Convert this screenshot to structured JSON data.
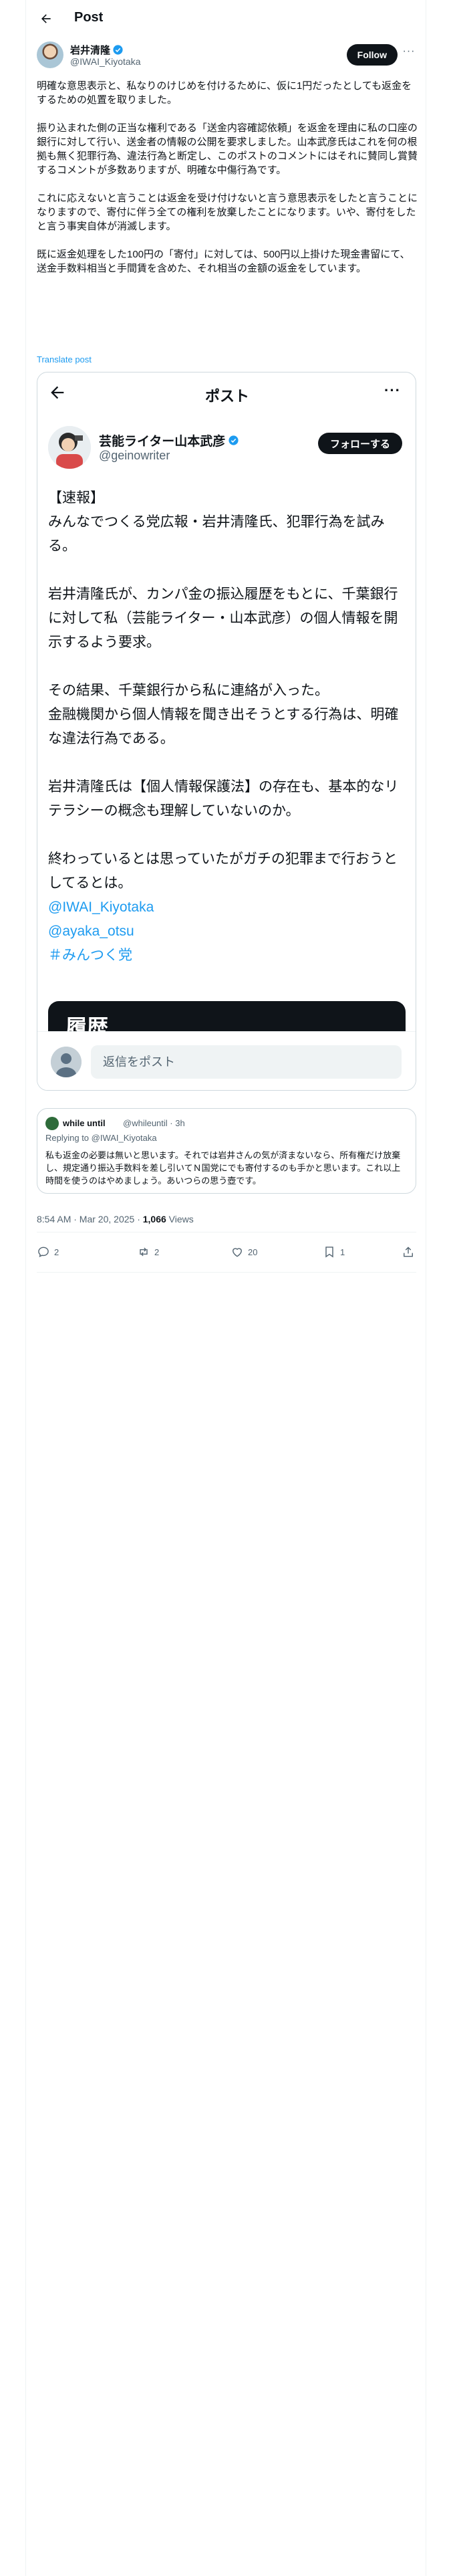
{
  "header": {
    "title": "Post"
  },
  "author": {
    "name": "岩井清隆",
    "handle": "@IWAI_Kiyotaka",
    "follow_label": "Follow"
  },
  "tweet": {
    "paragraphs": [
      "明確な意思表示と、私なりのけじめを付けるために、仮に1円だったとしても返金をするための処置を取りました。",
      "振り込まれた側の正当な権利である「送金内容確認依頼」を返金を理由に私の口座の銀行に対して行い、送金者の情報の公開を要求しました。山本武彦氏はこれを何の根拠も無く犯罪行為、違法行為と断定し、このポストのコメントにはそれに賛同し賞賛するコメントが多数ありますが、明確な中傷行為です。",
      "これに応えないと言うことは返金を受け付けないと言う意思表示をしたと言うことになりますので、寄付に伴う全ての権利を放棄したことになります。いや、寄付をしたと言う事実自体が消滅します。",
      "既に返金処理をした100円の「寄付」に対しては、500円以上掛けた現金書留にて、送金手数料相当と手間賃を含めた、それ相当の金額の返金をしています。"
    ],
    "translate_label": "Translate post"
  },
  "embed": {
    "title": "ポスト",
    "author_name": "芸能ライター山本武彦",
    "author_handle": "@geinowriter",
    "follow_label": "フォローする",
    "paragraphs": [
      "【速報】\nみんなでつくる党広報・岩井清隆氏、犯罪行為を試みる。",
      "岩井清隆氏が、カンパ金の振込履歴をもとに、千葉銀行に対して私（芸能ライター・山本武彦）の個人情報を開示するよう要求。",
      "その結果、千葉銀行から私に連絡が入った。\n金融機関から個人情報を聞き出そうとする行為は、明確な違法行為である。",
      "岩井清隆氏は【個人情報保護法】の存在も、基本的なリテラシーの概念も理解していないのか。"
    ],
    "closing": "終わっているとは思っていたがガチの犯罪まで行おうとしてるとは。",
    "links": [
      "@IWAI_Kiyotaka",
      "@ayaka_otsu",
      "＃みんつく党"
    ],
    "image_title": "履歴",
    "reply_placeholder": "返信をポスト"
  },
  "quote": {
    "name": "while until",
    "handle": "@whileuntil",
    "time": "3h",
    "replying_to": "Replying to @IWAI_Kiyotaka",
    "text": "私も返金の必要は無いと思います。それでは岩井さんの気が済まないなら、所有権だけ放棄し、規定通り振込手数料を差し引いてＮ国党にでも寄付するのも手かと思います。これ以上時間を使うのはやめましょう。あいつらの思う壺です。"
  },
  "meta": {
    "timestamp": "8:54 AM · Mar 20, 2025 · ",
    "views_count": "1,066",
    "views_label": " Views"
  },
  "actions": {
    "replies": "2",
    "reposts": "2",
    "likes": "20",
    "bookmarks": "1"
  },
  "colors": {
    "accent": "#1d9bf0",
    "text": "#0f1419",
    "muted": "#536471",
    "border": "#cfd9de"
  },
  "icons": [
    "back-arrow-icon",
    "verified-badge-icon",
    "more-icon",
    "reply-icon",
    "repost-icon",
    "like-icon",
    "bookmark-icon",
    "share-icon"
  ]
}
